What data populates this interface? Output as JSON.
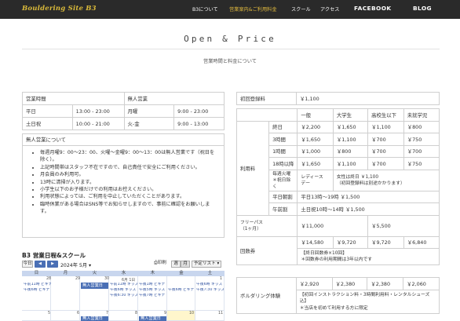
{
  "header": {
    "logo": "Bouldering Site B3",
    "nav": [
      "B3について",
      "営業案内&ご利用料金",
      "スクール",
      "アクセス"
    ],
    "facebook": "FACEBOOK",
    "blog": "BLOG"
  },
  "page": {
    "title": "Open & Price",
    "subtitle": "営業時間と料金について"
  },
  "hours_table": {
    "rows": [
      [
        "営業時間",
        "",
        "無人営業",
        ""
      ],
      [
        "平日",
        "13:00 - 23:00",
        "月曜",
        "9:00 - 23:00"
      ],
      [
        "土日祝",
        "10:00 - 21:00",
        "火-金",
        "9:00 - 13:00"
      ]
    ]
  },
  "unmanned": {
    "heading": "無人営業について",
    "items": [
      "毎週月曜9：00〜23：00、火曜〜金曜9：00〜13：00は無人営業です（祝日を除く）。",
      "上記時間帯はスタッフ不在ですので、自己責任で安全にご利用ください。",
      "月会員のみ利用可。",
      "13時に清掃が入ります。",
      "小学生以下のお子様だけでの利用はお控えください。",
      "利用状態によっては、ご利用を中止していただくことがあります。",
      "臨時休業がある場合はSNS等でお知らせしますので、事前に確認をお願いします。"
    ]
  },
  "registration": {
    "label": "初回登録料",
    "price": "￥1,100"
  },
  "price_table": {
    "headers": [
      "一般",
      "大学生",
      "高校生以下",
      "未就学児"
    ],
    "usage_label": "利用料",
    "usage_rows": [
      [
        "終日",
        "￥2,200",
        "￥1,650",
        "￥1,100",
        "￥800"
      ],
      [
        "3時間",
        "￥1,650",
        "￥1,100",
        "￥700",
        "￥750"
      ],
      [
        "1時間",
        "￥1,000",
        "￥800",
        "￥700",
        "￥700"
      ],
      [
        "18時以降",
        "￥1,650",
        "￥1,100",
        "￥700",
        "￥750"
      ]
    ],
    "tuesday": {
      "label": "毎週火曜\n＊祝日除く",
      "lady": "レディース\nデー",
      "note": "女性は終日 ￥1,100\n（初回登録料は別途かかります）"
    },
    "weekday_early": {
      "label": "平日朝割",
      "value": "平日13時〜19時 ￥1,500"
    },
    "morning": {
      "label": "午前割",
      "value": "土日祝10時〜14時 ￥1,500"
    },
    "freepass": {
      "label": "フリーパス\n（1ヶ月）",
      "general": "￥11,000",
      "student": "￥5,500"
    },
    "ticket": {
      "label": "回数券",
      "v1": "￥14,580",
      "v2": "￥9,720",
      "v3": "￥9,720",
      "v4": "￥6,840",
      "note": "【終日回数券×10回】\n＊回数券の利用期間は3年以内です"
    }
  },
  "bouldering_exp": {
    "label": "ボルダリング体験",
    "prices": [
      "￥2,920",
      "￥2,380",
      "￥2,380",
      "￥2,060"
    ],
    "note": "【初回インストラクション料・3時間利用料・レンタルシューズ込】\n＊当店を初めて利用する方に限定"
  },
  "calendar": {
    "title": "B3 営業日程&スクール",
    "today_button": "今日",
    "month": "2024年 5月",
    "print": "印刷",
    "week": "週",
    "month_view": "月",
    "agenda": "予定リスト",
    "days": [
      "日",
      "月",
      "火",
      "水",
      "木",
      "金",
      "土"
    ],
    "row1_dates": [
      "",
      "29",
      "30",
      "6月 1日",
      "",
      "",
      ""
    ],
    "row1_top": [
      "28",
      "",
      "",
      "",
      "",
      "",
      ""
    ],
    "row1_top2": [
      "",
      "",
      "",
      "",
      "",
      "",
      "1"
    ],
    "row2_dates": [
      "5",
      "6",
      "7",
      "8",
      "9",
      "10",
      "11"
    ],
    "events_sun": [
      "午前11時 ビギナ",
      "午後6時 ビギナ"
    ],
    "events_wed": [
      "午前11時 キッズ",
      "午後6時 キッズ",
      "午後6:30 キッズ"
    ],
    "events_thu": [
      "午後1時 ビギナ",
      "午後5時 キッズ",
      "午後7時 ビギナ"
    ],
    "events_sat": [
      "午後6時 キッズ",
      "午後7:30 キッズ"
    ],
    "events_fri": [
      "午後6時 ビギナ"
    ],
    "unmanned_event": "無人営業日",
    "row2_events": [
      "無人営業日",
      "無人営業日"
    ],
    "accent": "#4a6fb5"
  }
}
